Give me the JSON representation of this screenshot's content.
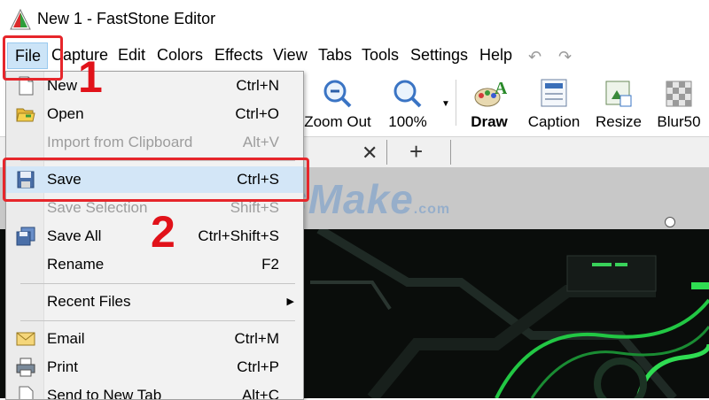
{
  "window": {
    "title": "New 1 - FastStone Editor"
  },
  "menubar": {
    "file": "File",
    "items": [
      "Capture",
      "Edit",
      "Colors",
      "Effects",
      "View",
      "Tabs",
      "Tools",
      "Settings",
      "Help"
    ],
    "undo_icon": "undo-icon",
    "redo_icon": "redo-icon"
  },
  "toolbar": {
    "zoom_out": "Zoom Out",
    "zoom_100": "100%",
    "draw": "Draw",
    "caption": "Caption",
    "resize": "Resize",
    "blur": "Blur50"
  },
  "tabs": {
    "close": "✕",
    "add": "+"
  },
  "watermark": {
    "text": "TipsMake",
    "suffix": ".com"
  },
  "file_menu": {
    "items": [
      {
        "label": "New",
        "shortcut": "Ctrl+N",
        "icon": "new-file-icon",
        "enabled": true
      },
      {
        "label": "Open",
        "shortcut": "Ctrl+O",
        "icon": "open-folder-icon",
        "enabled": true
      },
      {
        "label": "Import from Clipboard",
        "shortcut": "Alt+V",
        "icon": "",
        "enabled": false
      },
      {
        "label": "Save",
        "shortcut": "Ctrl+S",
        "icon": "floppy-disk-icon",
        "enabled": true,
        "highlighted": true
      },
      {
        "label": "Save Selection",
        "shortcut": "Shift+S",
        "icon": "",
        "enabled": false
      },
      {
        "label": "Save All",
        "shortcut": "Ctrl+Shift+S",
        "icon": "save-all-icon",
        "enabled": true
      },
      {
        "label": "Rename",
        "shortcut": "F2",
        "icon": "",
        "enabled": true
      },
      {
        "label": "Recent Files",
        "shortcut": "",
        "icon": "",
        "enabled": true,
        "submenu": true
      },
      {
        "label": "Email",
        "shortcut": "Ctrl+M",
        "icon": "email-icon",
        "enabled": true
      },
      {
        "label": "Print",
        "shortcut": "Ctrl+P",
        "icon": "printer-icon",
        "enabled": true
      },
      {
        "label": "Send to New Tab",
        "shortcut": "Alt+C",
        "icon": "new-tab-icon",
        "enabled": true
      }
    ]
  },
  "annotations": {
    "step1": "1",
    "step2": "2"
  },
  "colors": {
    "red_highlight": "#e6262b",
    "menu_highlight": "#d3e6f7",
    "file_active": "#cce4f7"
  }
}
